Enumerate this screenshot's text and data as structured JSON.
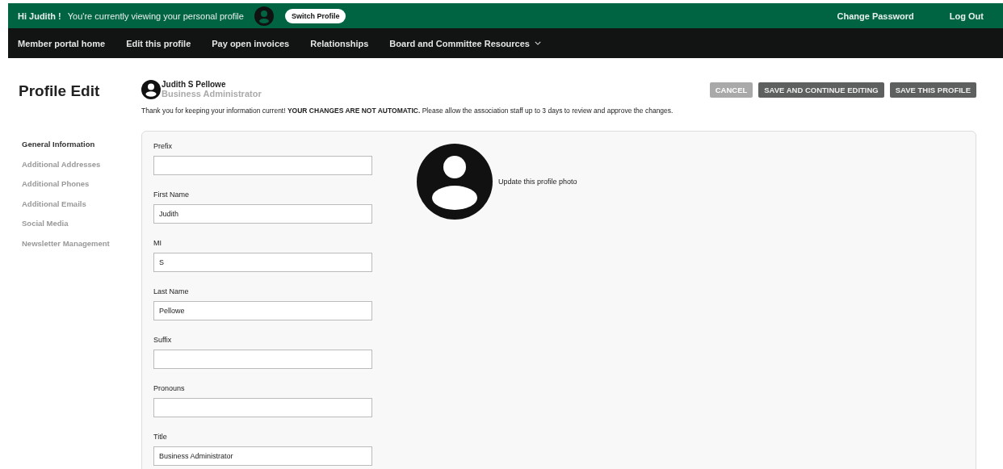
{
  "top_bar": {
    "greeting": "Hi Judith !",
    "status": "You're currently viewing your personal profile",
    "switch_button": "Switch Profile",
    "links": [
      "Change Password",
      "Log Out"
    ]
  },
  "nav": {
    "items": [
      {
        "label": "Member portal home",
        "has_menu": false
      },
      {
        "label": "Edit this profile",
        "has_menu": false
      },
      {
        "label": "Pay open invoices",
        "has_menu": false
      },
      {
        "label": "Relationships",
        "has_menu": false
      },
      {
        "label": "Board and Committee Resources",
        "has_menu": true
      }
    ]
  },
  "page": {
    "title": "Profile Edit",
    "user_name": "Judith S Pellowe",
    "user_role": "Business Administrator",
    "notice": "Thank you for keeping your information current! **YOUR CHANGES ARE NOT AUTOMATIC.** Please allow the association staff up to 3 days to review and approve the changes."
  },
  "actions": [
    {
      "label": "CANCEL",
      "disabled": true
    },
    {
      "label": "SAVE AND CONTINUE EDITING",
      "disabled": false
    },
    {
      "label": "SAVE THIS PROFILE",
      "disabled": false
    }
  ],
  "sidebar": {
    "items": [
      {
        "label": "General Information",
        "selected": true
      },
      {
        "label": "Additional Addresses",
        "selected": false
      },
      {
        "label": "Additional Phones",
        "selected": false
      },
      {
        "label": "Additional Emails",
        "selected": false
      },
      {
        "label": "Social Media",
        "selected": false
      },
      {
        "label": "Newsletter Management",
        "selected": false
      }
    ]
  },
  "form": {
    "fields": [
      {
        "label": "Prefix"
      },
      {
        "label": "First Name",
        "value": "Judith"
      },
      {
        "label": "MI",
        "value": "S"
      },
      {
        "label": "Last Name",
        "value": "Pellowe"
      },
      {
        "label": "Suffix"
      },
      {
        "label": "Pronouns"
      },
      {
        "label": "Title",
        "value": "Business Administrator"
      }
    ],
    "photo_link": "Update this profile photo"
  }
}
